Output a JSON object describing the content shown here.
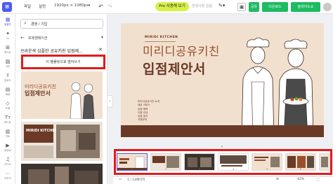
{
  "topbar": {
    "menu_file": "파일",
    "menu_settings": "설정",
    "canvas_size": "1920px × 1080px",
    "pro_button": "Pro 사용해 보기",
    "autosave_status": "변경사항 없음",
    "share_label": "공유",
    "download_label": "다운로드",
    "slideshow_label": "슬라이드쇼"
  },
  "rail": {
    "items": [
      {
        "label": "템플릿",
        "icon": "template-icon"
      },
      {
        "label": "AI",
        "icon": "sparkle-icon"
      },
      {
        "label": "텍스트",
        "icon": "grid-icon"
      },
      {
        "label": "사진",
        "icon": "photo-icon"
      },
      {
        "label": "업로드",
        "icon": "upload-icon"
      },
      {
        "label": "배경",
        "icon": "background-icon"
      },
      {
        "label": "도형",
        "icon": "shape-icon"
      },
      {
        "label": "텍스트",
        "icon": "text-icon"
      },
      {
        "label": "차트",
        "icon": "chart-icon"
      },
      {
        "label": "동영상",
        "icon": "video-icon"
      },
      {
        "label": "오디오",
        "icon": "music-icon"
      },
      {
        "label": "더보기",
        "icon": "more-icon"
      }
    ]
  },
  "panel": {
    "search_value": "경영 / 기업",
    "back_label": "프레젠테이션",
    "template_title": "브라운색 심플한 공유키친 입점제...",
    "view_page_button": "이 템플릿으로 덮어쓰기",
    "thumb1_title_a": "미리디공유키친",
    "thumb1_title_b": "입점제안서",
    "thumb2_title": "MIRIDI KITCHEN"
  },
  "slide": {
    "brand": "MIRIDI KITCHEN",
    "title_line1": "미리디공유키친",
    "title_line2": "입점제안서",
    "info_lines": [
      "미리디공유키친 소개",
      "제공 서비스",
      "입점 혜택",
      "이용 안내",
      "입점 절차",
      "지원문의"
    ]
  },
  "filmstrip": {
    "page_numbers": [
      "1",
      "2",
      "3",
      "4",
      "5",
      "6"
    ]
  },
  "bottombar": {
    "page_status": "1 / 14페이지",
    "zoom_level": "42%"
  },
  "colors": {
    "brand_blue": "#4a5cf4",
    "green": "#1dbb62",
    "pro_yellow": "#d9f04a",
    "highlight_red": "#e21a1a",
    "slide_bg": "#f2e0cf",
    "slide_brown": "#6b3a26"
  }
}
